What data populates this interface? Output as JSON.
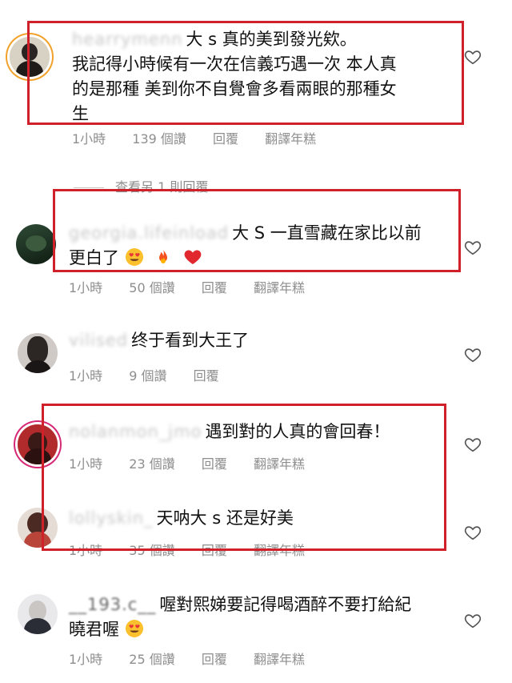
{
  "comments": [
    {
      "username": "hearrymenn",
      "text_line1": "大 s 真的美到發光欸。",
      "text_rest": "我記得小時候有一次在信義巧遇一次 本人真的是那種 美到你不自覺會多看兩眼的那種女生",
      "text_line2": "我記得小時候有一次在信義巧遇一次 本人真",
      "text_line3": "的是那種 美到你不自覺會多看兩眼的那種女",
      "text_line4": "生",
      "time": "1小時",
      "likes": "139 個讚",
      "reply": "回覆",
      "translate": "翻譯年糕",
      "view_replies": "查看另 1 則回覆"
    },
    {
      "username": "georgia.lifeinload",
      "text_line1": "大 S 一直雪藏在家比以前",
      "text_line2": "更白了",
      "emojis": [
        "smiling-face-heart-eyes",
        "fire",
        "red-heart"
      ],
      "time": "1小時",
      "likes": "50 個讚",
      "reply": "回覆",
      "translate": "翻譯年糕"
    },
    {
      "username": "vilised",
      "text_line1": "终于看到大王了",
      "time": "1小時",
      "likes": "9 個讚",
      "reply": "回覆"
    },
    {
      "username": "nolanmon_jmo",
      "text_line1": "遇到對的人真的會回春！",
      "time": "1小時",
      "likes": "23 個讚",
      "reply": "回覆",
      "translate": "翻譯年糕"
    },
    {
      "username": "lollyskin_",
      "text_line1": "天呐大 s 还是好美",
      "time": "1小時",
      "likes": "35 個讚",
      "reply": "回覆",
      "translate": "翻譯年糕"
    },
    {
      "username": "__193.c__",
      "text_line1": "喔對熙娣要記得喝酒醉不要打給紀",
      "text_line2": "曉君喔",
      "emojis": [
        "smiling-face-heart-eyes"
      ],
      "time": "1小時",
      "likes": "25 個讚",
      "reply": "回覆",
      "translate": "翻譯年糕"
    }
  ],
  "colors": {
    "highlight_box": "#d0202a",
    "meta_text": "#8e8e8e",
    "story_ring": "#f2a12b"
  },
  "icons": {
    "like": "heart-outline-icon"
  }
}
